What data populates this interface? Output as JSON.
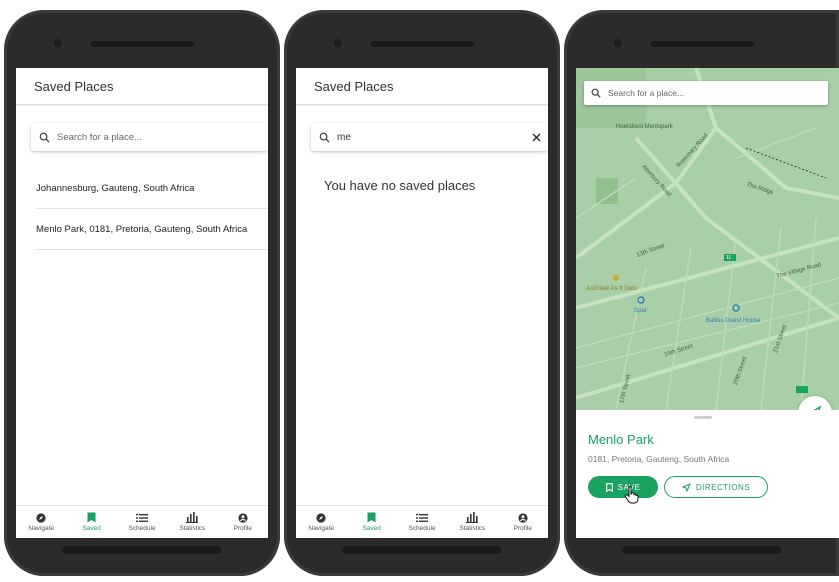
{
  "screens": [
    {
      "title": "Saved Places",
      "search": {
        "placeholder": "Search for a place...",
        "value": ""
      },
      "items": [
        {
          "label": "Johannesburg, Gauteng, South Africa"
        },
        {
          "label": "Menlo Park, 0181, Pretoria, Gauteng, South Africa"
        }
      ]
    },
    {
      "title": "Saved Places",
      "search": {
        "placeholder": "Search for a place...",
        "value": "me",
        "clear_icon": "close-icon"
      },
      "empty_message": "You have no saved places"
    },
    {
      "search": {
        "placeholder": "Search for a place..."
      },
      "map_labels": {
        "road1": "Atterbury Road",
        "road2": "Rosemary Road",
        "road3": "The Ridge",
        "road4": "13th Street",
        "road5": "The Village Road",
        "poi1": "AsGreek As It Gets",
        "poi2": "Spar",
        "poi3": "Baltiss Guest House",
        "road6": "15th Street",
        "road7": "20th Street",
        "road8": "21st Street",
        "road9": "17th Street",
        "poi4": "Hoerskool Menlopark",
        "route_badge": "11"
      },
      "place": {
        "name": "Menlo Park",
        "address": "0181, Pretoria, Gauteng, South Africa",
        "save_label": "SAVE",
        "directions_label": "DIRECTIONS"
      }
    }
  ],
  "nav": {
    "items": [
      {
        "label": "Navigate",
        "icon": "compass-icon"
      },
      {
        "label": "Saved",
        "icon": "bookmark-icon"
      },
      {
        "label": "Schedule",
        "icon": "list-icon"
      },
      {
        "label": "Statistics",
        "icon": "bar-chart-icon"
      },
      {
        "label": "Profile",
        "icon": "account-icon"
      }
    ],
    "active_index": 1
  },
  "colors": {
    "accent": "#1aa260",
    "map_green": "#a9cfa8",
    "phone": "#2b2b2b"
  }
}
